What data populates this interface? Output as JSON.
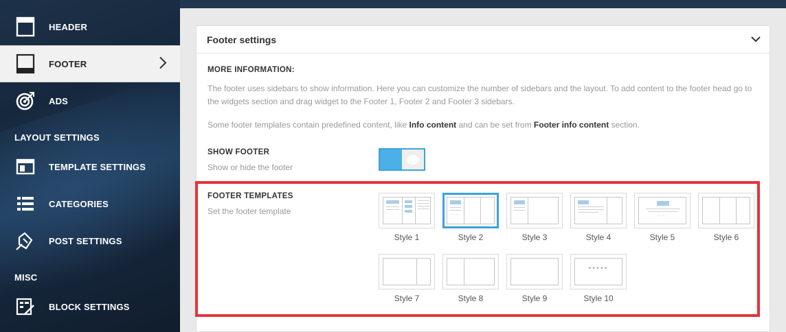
{
  "sidebar": {
    "items": [
      {
        "label": "HEADER",
        "icon": "header-layout-icon"
      },
      {
        "label": "FOOTER",
        "icon": "footer-layout-icon",
        "active": true
      },
      {
        "label": "ADS",
        "icon": "target-icon"
      },
      {
        "label": "TEMPLATE SETTINGS",
        "icon": "template-window-icon"
      },
      {
        "label": "CATEGORIES",
        "icon": "list-icon"
      },
      {
        "label": "POST SETTINGS",
        "icon": "post-edit-icon"
      },
      {
        "label": "BLOCK SETTINGS",
        "icon": "block-edit-icon"
      }
    ],
    "sections": [
      "LAYOUT SETTINGS",
      "MISC"
    ]
  },
  "panel": {
    "title": "Footer settings",
    "more_info_title": "MORE INFORMATION:",
    "more_info_text": "The footer uses sidebars to show information. Here you can customize the number of sidebars and the layout. To add content to the footer head go to the widgets section and drag widget to the Footer 1, Footer 2 and Footer 3 sidebars.",
    "more_info_text2_a": "Some footer templates contain predefined content, like ",
    "more_info_text2_b": "Info content",
    "more_info_text2_c": " and can be set from ",
    "more_info_text2_d": "Footer info content",
    "more_info_text2_e": " section.",
    "show_footer_title": "SHOW FOOTER",
    "show_footer_desc": "Show or hide the footer",
    "show_footer_enabled": true,
    "templates_title": "FOOTER TEMPLATES",
    "templates_desc": "Set the footer template",
    "selected_template": "Style 2",
    "templates": [
      "Style 1",
      "Style 2",
      "Style 3",
      "Style 4",
      "Style 5",
      "Style 6",
      "Style 7",
      "Style 8",
      "Style 9",
      "Style 10"
    ]
  },
  "colors": {
    "accent": "#3aa3db",
    "highlight_border": "#e5323b",
    "sidebar_bg": "#16283d"
  }
}
